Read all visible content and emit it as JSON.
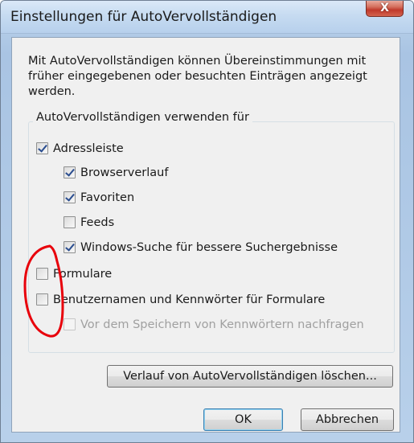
{
  "window": {
    "title": "Einstellungen für AutoVervollständigen",
    "close_label": "X"
  },
  "dialog": {
    "description": "Mit AutoVervollständigen können Übereinstimmungen mit\nfrüher eingegebenen oder besuchten Einträgen angezeigt\nwerden.",
    "group_label": "AutoVervollständigen verwenden für",
    "checkboxes": [
      {
        "label": "Adressleiste",
        "checked": true,
        "enabled": true
      },
      {
        "label": "Browserverlauf",
        "checked": true,
        "enabled": true
      },
      {
        "label": "Favoriten",
        "checked": true,
        "enabled": true
      },
      {
        "label": "Feeds",
        "checked": false,
        "enabled": true
      },
      {
        "label": "Windows-Suche für bessere Suchergebnisse",
        "checked": true,
        "enabled": true
      },
      {
        "label": "Formulare",
        "checked": false,
        "enabled": true
      },
      {
        "label": "Benutzernamen und Kennwörter für Formulare",
        "checked": false,
        "enabled": true
      },
      {
        "label": "Vor dem Speichern von Kennwörtern nachfragen",
        "checked": false,
        "enabled": false
      }
    ],
    "clear_history_label": "Verlauf von AutoVervollständigen löschen...",
    "ok_label": "OK",
    "cancel_label": "Abbrechen"
  },
  "annotation": {
    "color": "#e8000b"
  }
}
